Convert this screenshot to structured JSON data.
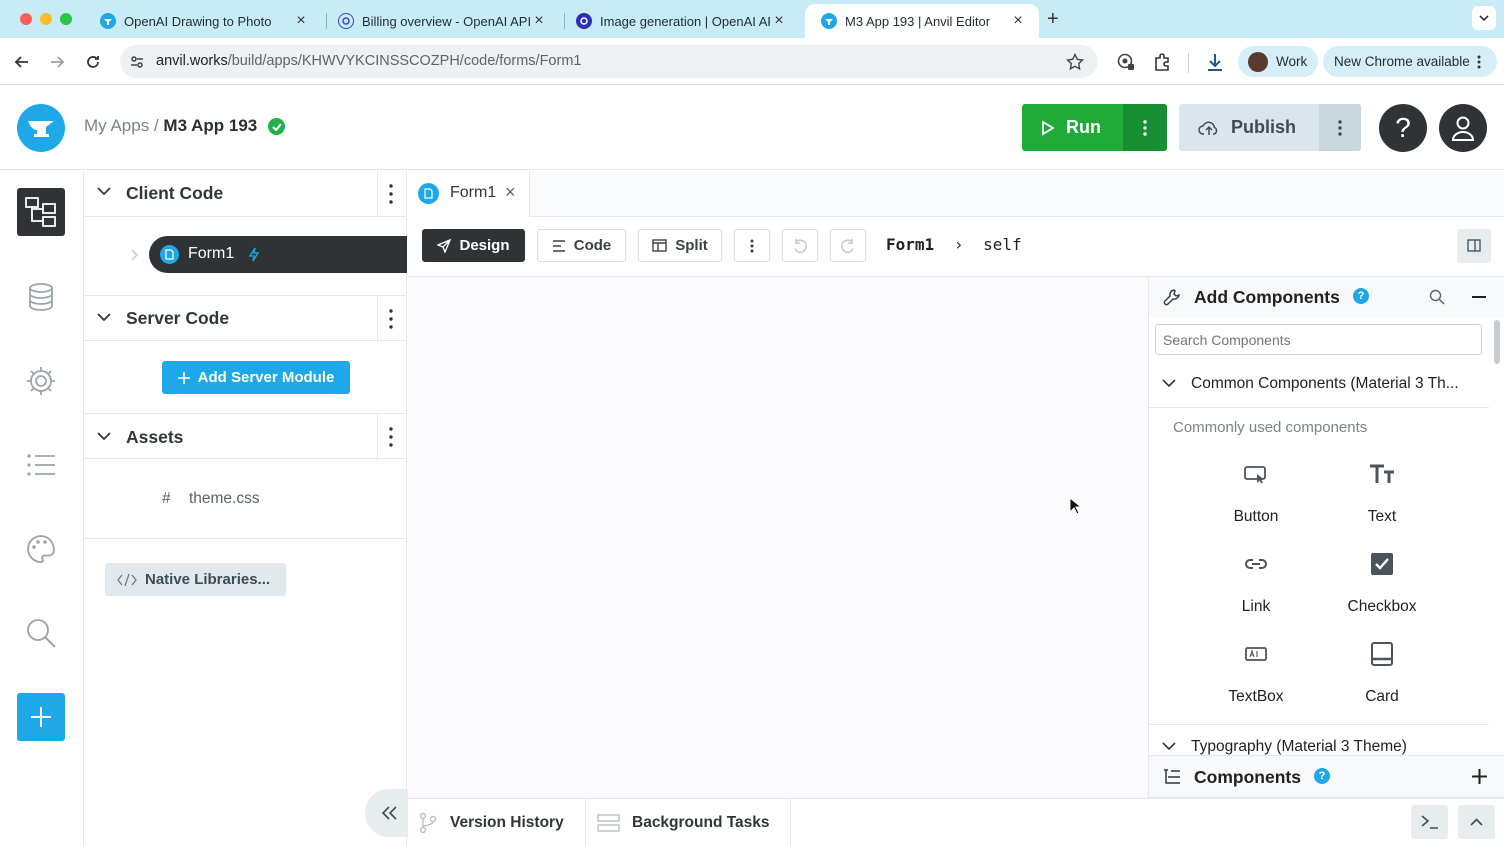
{
  "browser": {
    "tabs": [
      {
        "title": "OpenAI Drawing to Photo",
        "favicon": "anvil-icon"
      },
      {
        "title": "Billing overview - OpenAI API",
        "favicon": "openai-icon"
      },
      {
        "title": "Image generation | OpenAI AP",
        "favicon": "openai-icon"
      },
      {
        "title": "M3 App 193 | Anvil Editor",
        "favicon": "anvil-icon"
      }
    ],
    "new_tab": "+",
    "url_host": "anvil.works",
    "url_path": "/build/apps/KHWVYKCINSSCOZPH/code/forms/Form1",
    "profile_label": "Work",
    "update_label": "New Chrome available"
  },
  "header": {
    "crumb_parent": "My Apps",
    "crumb_sep": "/",
    "app_name": "M3 App 193",
    "run_label": "Run",
    "publish_label": "Publish",
    "help_label": "?"
  },
  "tree": {
    "client_title": "Client Code",
    "form_item": "Form1",
    "server_title": "Server Code",
    "add_server_label": "Add Server Module",
    "assets_title": "Assets",
    "asset_hash": "#",
    "asset_file": "theme.css",
    "native_libs_label": "Native Libraries..."
  },
  "editor": {
    "open_tab": "Form1",
    "design_label": "Design",
    "code_label": "Code",
    "split_label": "Split",
    "path_form": "Form1",
    "path_sep": "›",
    "path_self": "self"
  },
  "components": {
    "title": "Add Components",
    "search_placeholder": "Search Components",
    "section_title": "Common Components (Material 3 Th...",
    "section_subtitle": "Commonly used components",
    "items": [
      "Button",
      "Text",
      "Link",
      "Checkbox",
      "TextBox",
      "Card"
    ],
    "next_section": "Typography (Material 3 Theme)",
    "footer_title": "Components",
    "help_badge": "?"
  },
  "bottom": {
    "version_history": "Version History",
    "background_tasks": "Background Tasks"
  },
  "colors": {
    "anvil_blue": "#1fa8e8",
    "run_green": "#1faa3a",
    "dark": "#303336"
  }
}
